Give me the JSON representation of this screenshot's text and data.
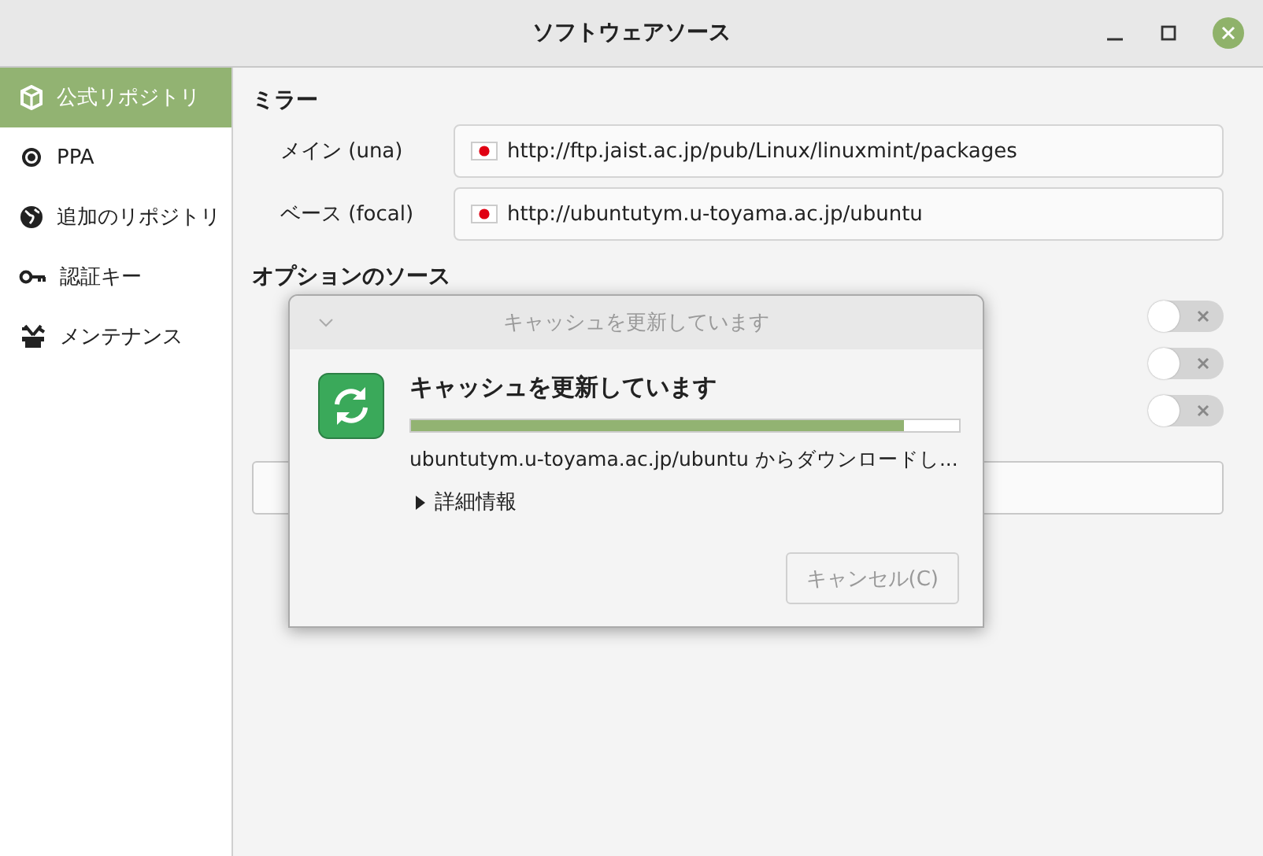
{
  "window": {
    "title": "ソフトウェアソース"
  },
  "sidebar": {
    "items": [
      {
        "label": "公式リポジトリ",
        "selected": true
      },
      {
        "label": "PPA",
        "selected": false
      },
      {
        "label": "追加のリポジトリ",
        "selected": false
      },
      {
        "label": "認証キー",
        "selected": false
      },
      {
        "label": "メンテナンス",
        "selected": false
      }
    ]
  },
  "mirrors": {
    "title": "ミラー",
    "rows": [
      {
        "label": "メイン (una)",
        "value": "http://ftp.jaist.ac.jp/pub/Linux/linuxmint/packages"
      },
      {
        "label": "ベース (focal)",
        "value": "http://ubuntutym.u-toyama.ac.jp/ubuntu"
      }
    ]
  },
  "optional_sources": {
    "title": "オプションのソース",
    "toggles": [
      {
        "on": false
      },
      {
        "on": false
      },
      {
        "on": false
      }
    ]
  },
  "dialog": {
    "title": "キャッシュを更新しています",
    "heading": "キャッシュを更新しています",
    "level": 0.9,
    "status": "ubuntutym.u-toyama.ac.jp/ubuntu からダウンロードし...",
    "details": {
      "label": "詳細情報",
      "expanded": false
    },
    "cancel": {
      "label": "キャンセル(C)",
      "disabled": true
    }
  }
}
